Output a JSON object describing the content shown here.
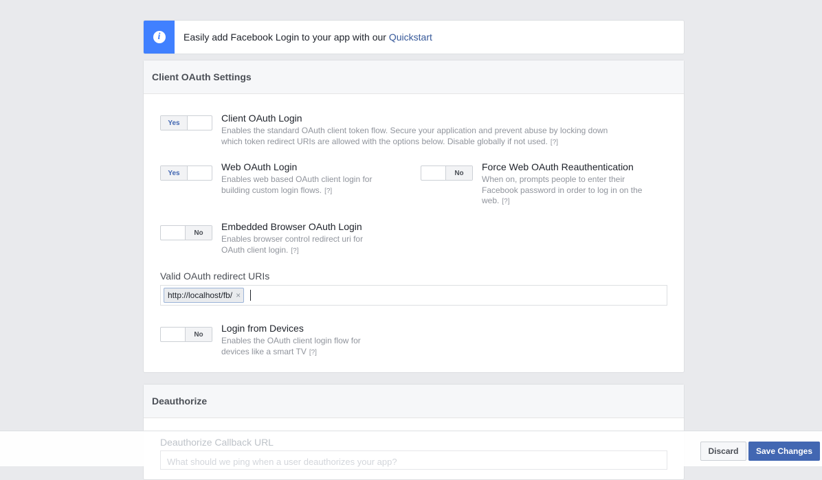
{
  "banner": {
    "text": "Easily add Facebook Login to your app with our ",
    "link": "Quickstart"
  },
  "client_oauth": {
    "header": "Client OAuth Settings",
    "settings": {
      "client_oauth_login": {
        "toggle": "Yes",
        "title": "Client OAuth Login",
        "desc_line1": "Enables the standard OAuth client token flow. Secure your application and prevent abuse by locking down",
        "desc_line2": "which token redirect URIs are allowed with the options below. Disable globally if not used.",
        "help": "[?]"
      },
      "web_oauth_login": {
        "toggle": "Yes",
        "title": "Web OAuth Login",
        "desc_line1": "Enables web based OAuth client login for",
        "desc_line2": "building custom login flows.",
        "help": "[?]"
      },
      "force_web_reauth": {
        "toggle": "No",
        "title": "Force Web OAuth Reauthentication",
        "desc_line1": "When on, prompts people to enter their",
        "desc_line2": "Facebook password in order to log in on the",
        "desc_line3": "web.",
        "help": "[?]"
      },
      "embedded_browser": {
        "toggle": "No",
        "title": "Embedded Browser OAuth Login",
        "desc_line1": "Enables browser control redirect uri for",
        "desc_line2": "OAuth client login.",
        "help": "[?]"
      },
      "login_from_devices": {
        "toggle": "No",
        "title": "Login from Devices",
        "desc_line1": "Enables the OAuth client login flow for",
        "desc_line2": "devices like a smart TV",
        "help": "[?]"
      }
    },
    "redirect_uris": {
      "label": "Valid OAuth redirect URIs",
      "tags": [
        "http://localhost/fb/"
      ],
      "remove_glyph": "×"
    }
  },
  "deauthorize": {
    "header": "Deauthorize",
    "callback_label": "Deauthorize Callback URL",
    "callback_placeholder": "What should we ping when a user deauthorizes your app?"
  },
  "footer": {
    "discard": "Discard",
    "save": "Save Changes"
  },
  "colors": {
    "accent": "#4267b2",
    "info": "#4080ff",
    "link": "#365899",
    "page_bg": "#e9eaed"
  },
  "icons": {
    "banner": "info-icon",
    "tag_remove": "close-icon"
  }
}
